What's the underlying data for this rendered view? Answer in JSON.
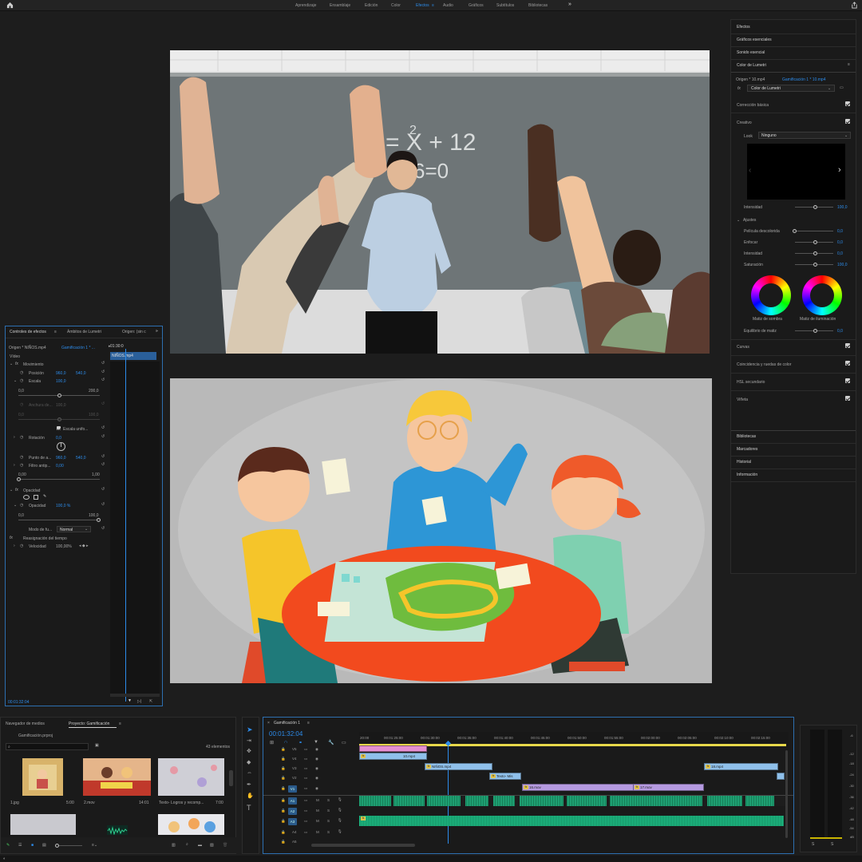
{
  "topbar": {
    "tabs": [
      "Aprendizaje",
      "Ensamblaje",
      "Edición",
      "Color",
      "Efectos",
      "Audio",
      "Gráficos",
      "Subtítulos",
      "Bibliotecas"
    ],
    "active_tab": "Efectos",
    "more": "»"
  },
  "right_panel": {
    "sections": [
      "Efectos",
      "Gráficos esenciales",
      "Sonido esencial",
      "Color de Lumetri"
    ],
    "source": "Origen * 10.mp4",
    "target": "Gamificación 1 * 10.mp4",
    "fx_label": "fx",
    "effect_dropdown": "Color de Lumetri",
    "basic_correction": "Corrección básica",
    "creative": "Creativo",
    "look_label": "Look",
    "look_value": "Ninguno",
    "intensity_label": "Intensidad",
    "intensity_value": "100,0",
    "adjustments": "Ajustes",
    "faded_film": "Película descolorida",
    "faded_film_value": "0,0",
    "sharpen": "Enfocar",
    "sharpen_value": "0,0",
    "vibrance": "Intensidad",
    "vibrance_value": "0,0",
    "saturation": "Saturación",
    "saturation_value": "100,0",
    "shadow_tint": "Matiz de sombra",
    "highlight_tint": "Matiz de iluminación",
    "tint_balance": "Equilibrio de matiz",
    "tint_balance_value": "0,0",
    "curves": "Curvas",
    "color_match": "Coincidencia y ruedas de color",
    "hsl": "HSL secundario",
    "vignette": "Viñeta",
    "bottom_sections": [
      "Bibliotecas",
      "Marcadores",
      "Historial",
      "Información"
    ]
  },
  "effects_controls": {
    "tabs": [
      "Controles de efectos",
      "Ámbitos de Lumetri",
      "Origen: (sin c"
    ],
    "source": "Origen * NIÑOS.mp4",
    "sequence": "Gamificación 1 * ...",
    "time_head": "01:30:0",
    "clip_label": "NIÑOS.mp4",
    "video": "Vídeo",
    "motion": "Movimiento",
    "position": "Posición",
    "position_x": "960,0",
    "position_y": "540,0",
    "scale": "Escala",
    "scale_value": "100,0",
    "scale_min": "0,0",
    "scale_max": "200,0",
    "scale_width": "Anchura de...",
    "scale_width_value": "100,0",
    "scale_width_min": "0,0",
    "scale_width_max": "100,0",
    "uniform_scale": "Escala unifo...",
    "rotation": "Rotación",
    "rotation_value": "0,0",
    "anchor": "Punto de a...",
    "anchor_x": "960,0",
    "anchor_y": "540,0",
    "flicker": "Filtro antip...",
    "flicker_value": "0,00",
    "flicker_min": "0,00",
    "flicker_max": "1,00",
    "opacity_section": "Opacidad",
    "opacity": "Opacidad",
    "opacity_value": "100,0 %",
    "opacity_min": "0,0",
    "opacity_max": "100,0",
    "blend_mode": "Modo de fu...",
    "blend_value": "Normal",
    "time_remap": "Reasignación del tiempo",
    "speed": "Velocidad",
    "speed_value": "100,00%",
    "timecode": "00:01:32:04"
  },
  "project": {
    "tabs": [
      "Navegador de medios",
      "Proyecto: Gamificación"
    ],
    "file": "Gamificación.prproj",
    "count": "43 elementos",
    "items": [
      {
        "name": "1.jpg",
        "duration": "5:00"
      },
      {
        "name": "2.mov",
        "duration": "14:01"
      },
      {
        "name": "Texto- Logros y recomp...",
        "duration": "7:00"
      }
    ]
  },
  "timeline": {
    "title": "Gamificación 1",
    "timecode": "00:01:32:04",
    "ruler": [
      "20:00",
      "00:01:25:00",
      "00:01:30:00",
      "00:01:35:00",
      "00:01:40:00",
      "00:01:45:00",
      "00:01:50:00",
      "00:01:55:00",
      "00:02:00:00",
      "00:02:05:00",
      "00:02:10:00",
      "00:02:15:00"
    ],
    "video_tracks": [
      "V5",
      "V4",
      "V3",
      "V2",
      "V1"
    ],
    "audio_tracks": [
      "A1",
      "A2",
      "A3",
      "A4",
      "A5"
    ],
    "clips": [
      "10.mp4",
      "NIÑOS.mp4",
      "Texto- Mis",
      "18.mp4",
      "16.mov",
      "17.mov"
    ],
    "mute": "M",
    "solo": "S"
  },
  "meter": {
    "ticks": [
      "-6",
      "-12",
      "-18",
      "-24",
      "-30",
      "-36",
      "-42",
      "-48",
      "-54",
      "dB"
    ],
    "solo": [
      "S",
      "S"
    ]
  }
}
